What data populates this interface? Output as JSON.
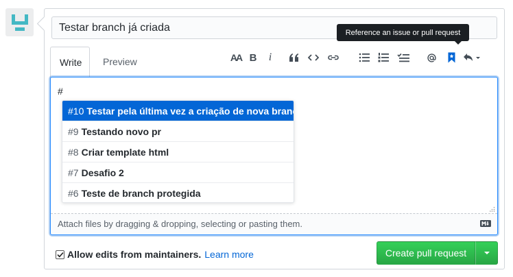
{
  "title_input": {
    "value": "Testar branch já criada"
  },
  "tabs": [
    {
      "label": "Write",
      "active": true
    },
    {
      "label": "Preview",
      "active": false
    }
  ],
  "toolbar": {
    "heading": "AA",
    "bold": "B",
    "italic": "i",
    "tooltip": "Reference an issue or pull request",
    "icons": [
      "text-size-icon",
      "bold-icon",
      "italic-icon",
      "quote-icon",
      "code-icon",
      "link-icon",
      "unordered-list-icon",
      "ordered-list-icon",
      "tasklist-icon",
      "mention-icon",
      "bookmark-icon",
      "reply-icon"
    ]
  },
  "editor": {
    "text": "#",
    "attach_hint": "Attach files by dragging & dropping, selecting or pasting them."
  },
  "suggestions": [
    {
      "num": "#10",
      "title": "Testar pela última vez a criação de nova branch",
      "selected": true
    },
    {
      "num": "#9",
      "title": "Testando novo pr",
      "selected": false
    },
    {
      "num": "#8",
      "title": "Criar template html",
      "selected": false
    },
    {
      "num": "#7",
      "title": "Desafio 2",
      "selected": false
    },
    {
      "num": "#6",
      "title": "Teste de branch protegida",
      "selected": false
    }
  ],
  "footer": {
    "allow_edits_label": "Allow edits from maintainers.",
    "allow_edits_checked": true,
    "learn_more": "Learn more",
    "submit_label": "Create pull request"
  },
  "colors": {
    "accent": "#0366d6",
    "button_green": "#28a745",
    "focus_blue": "#2188ff",
    "tooltip_bg": "#1b1f23",
    "avatar_teal": "#44b8c4"
  }
}
